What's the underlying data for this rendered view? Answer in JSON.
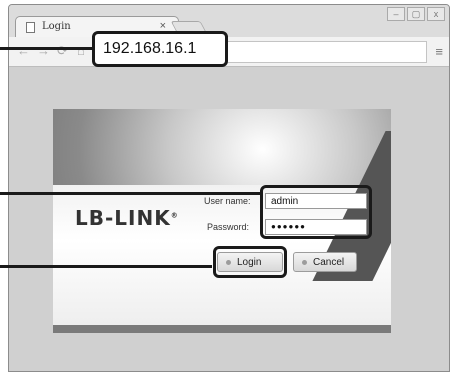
{
  "browser": {
    "tab_title": "Login",
    "tab_close": "×",
    "url": "192.168.16.1",
    "window_controls": [
      "–",
      "▢",
      "x"
    ],
    "nav_icons": [
      "back-arrow-icon",
      "forward-arrow-icon",
      "reload-icon",
      "home-icon"
    ],
    "menu_icon": "≡"
  },
  "login": {
    "logo_text": "LB-LINK",
    "logo_mark": "®",
    "username_label": "User name:",
    "username_value": "admin",
    "password_label": "Password:",
    "password_value": "●●●●●●",
    "login_button": "Login",
    "cancel_button": "Cancel"
  }
}
